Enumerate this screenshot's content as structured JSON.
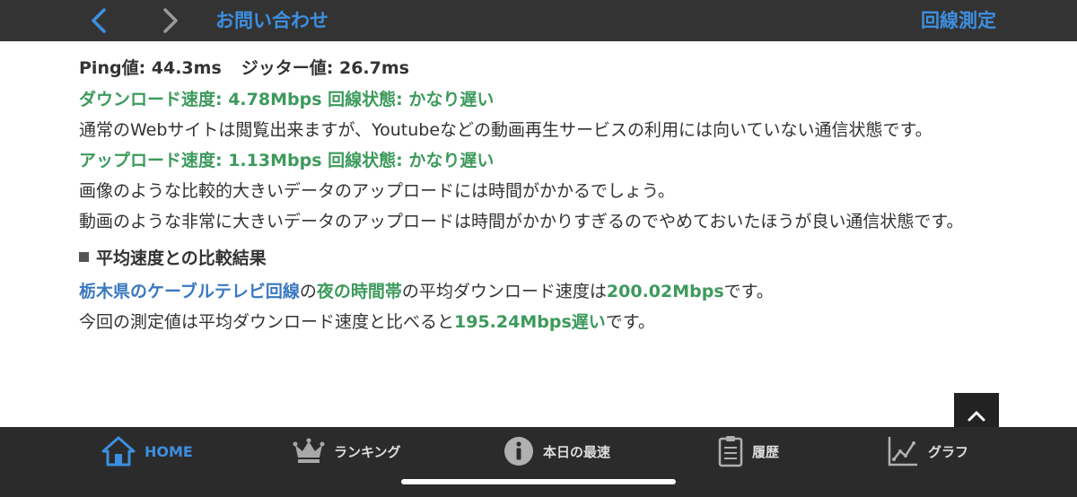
{
  "topbar": {
    "contact_label": "お問い合わせ",
    "measure_label": "回線測定",
    "accent_color": "#3d8fe0"
  },
  "results": {
    "ping": "Ping値: 44.3ms",
    "jitter": "ジッター値: 26.7ms",
    "download_heading": "ダウンロード速度: 4.78Mbps 回線状態: かなり遅い",
    "download_desc": "通常のWebサイトは閲覧出来ますが、Youtubeなどの動画再生サービスの利用には向いていない通信状態です。",
    "upload_heading": "アップロード速度: 1.13Mbps 回線状態: かなり遅い",
    "upload_desc_1": "画像のような比較的大きいデータのアップロードには時間がかかるでしょう。",
    "upload_desc_2": "動画のような非常に大きいデータのアップロードは時間がかかりすぎるのでやめておいたほうが良い通信状態です。"
  },
  "comparison": {
    "heading": "平均速度との比較結果",
    "line1_region": "栃木県のケーブルテレビ回線",
    "line1_mid1": "の",
    "line1_time": "夜の時間帯",
    "line1_mid2": "の平均ダウンロード速度は",
    "line1_speed": "200.02Mbps",
    "line1_end": "です。",
    "line2_start": "今回の測定値は平均ダウンロード速度と比べると",
    "line2_diff": "195.24Mbps遅い",
    "line2_end": "です。"
  },
  "tabbar": {
    "home": "HOME",
    "ranking": "ランキング",
    "best_today": "本日の最速",
    "history": "履歴",
    "graph": "グラフ"
  },
  "colors": {
    "green": "#3d9a5c",
    "blue": "#3a78c0",
    "bar_bg": "#333333"
  }
}
